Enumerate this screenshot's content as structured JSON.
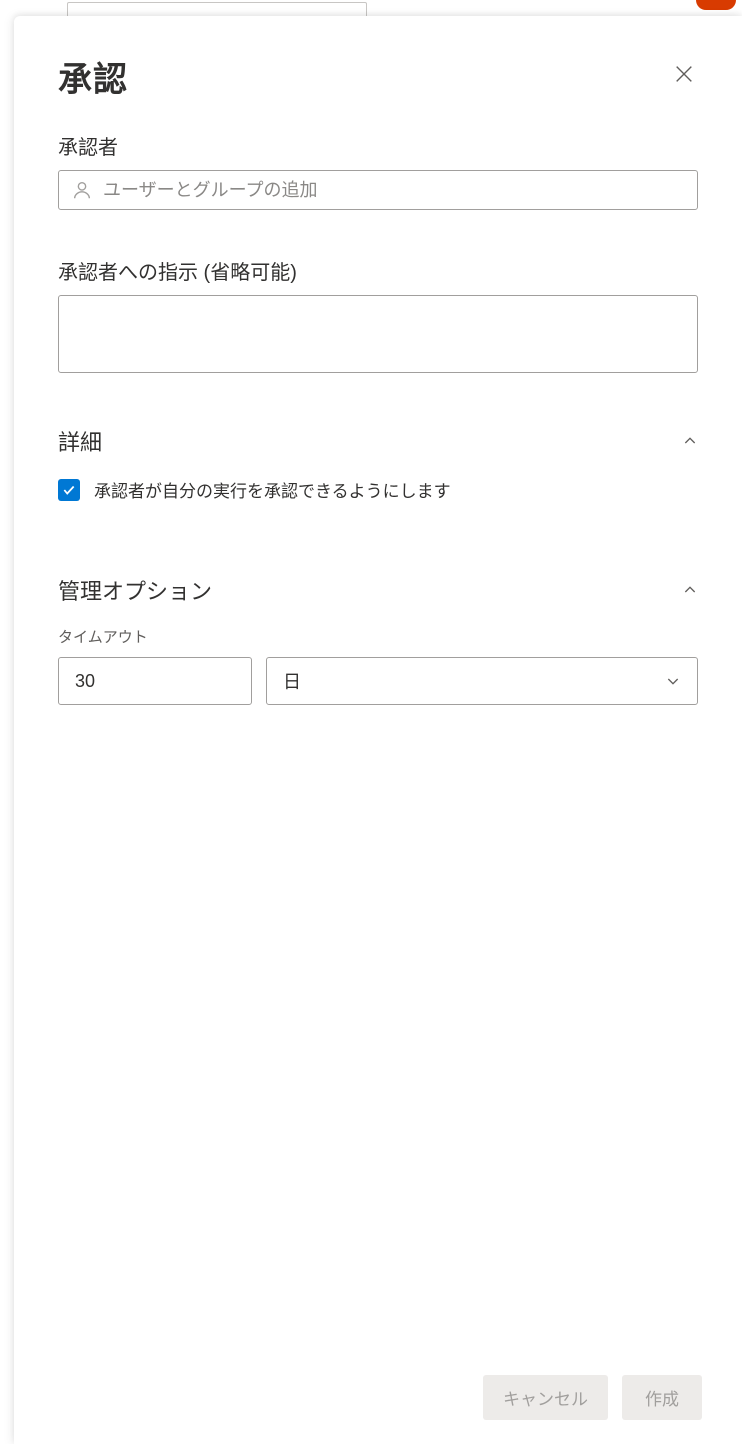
{
  "panel": {
    "title": "承認"
  },
  "approvers": {
    "label": "承認者",
    "placeholder": "ユーザーとグループの追加"
  },
  "instructions": {
    "label": "承認者への指示 (省略可能)",
    "value": ""
  },
  "details": {
    "title": "詳細",
    "checkbox_label": "承認者が自分の実行を承認できるようにします",
    "checked": true
  },
  "management": {
    "title": "管理オプション",
    "timeout_label": "タイムアウト",
    "timeout_value": "30",
    "timeout_unit": "日"
  },
  "footer": {
    "cancel": "キャンセル",
    "create": "作成"
  }
}
